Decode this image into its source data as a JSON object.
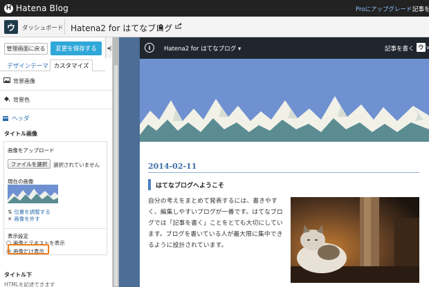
{
  "topbar": {
    "logo_mark": "H",
    "logo_text": "Hatena Blog",
    "pro_link": "Proにアップグレード",
    "write_link": "記事を書"
  },
  "subbar": {
    "blog_icon_text": "ウ",
    "dashboard": "ダッシュボード",
    "blog_title": "Hatena2 for はてなブログ",
    "lock_icon": "lock-icon",
    "caret": "▾",
    "external_icon": "external-link-icon"
  },
  "sidebar": {
    "back_button": "管理画面に戻る",
    "save_button": "変更を保存する",
    "collapse_glyph": "◂|",
    "tabs": [
      {
        "label": "デザインテーマ"
      },
      {
        "label": "カスタマイズ"
      }
    ],
    "sections": [
      {
        "icon": "image-icon",
        "label": "背景画像"
      },
      {
        "icon": "paint-bucket-icon",
        "label": "背景色"
      }
    ],
    "header_link": "ヘッダ",
    "title_image_heading": "タイトル画像",
    "upload_label": "画像をアップロード",
    "file_button": "ファイルを選択",
    "file_note": "選択されていません",
    "current_image_label": "現在の画像",
    "adjust_position": "位置を調整する",
    "remove_image": "画像を外す",
    "display_setting_label": "表示設定",
    "radio_options": [
      {
        "label": "画像とテキストを表示",
        "checked": false
      },
      {
        "label": "画像だけ表示",
        "checked": true
      }
    ],
    "below_title_heading": "タイトル下",
    "below_title_note": "HTMLを記述できます"
  },
  "preview": {
    "logo_mark": "i",
    "blog_title": "Hatena2 for はてなブログ ▾",
    "write_link": "記事を書く",
    "avatar_text": "ウ",
    "avatar_suffix": "v",
    "date": "2014-02-11",
    "post_title": "はてなブログへようこそ",
    "post_body": "自分の考えをまとめて発表するには、書きやすく、編集しやすいブログが一番です。はてなブログでは「記事を書く」ことをとても大切にしています。ブログを書いている人が最大限に集中できるように設計されています。"
  },
  "colors": {
    "accent_blue": "#2fa7d9",
    "link_blue": "#2a6bb0",
    "highlight_orange": "#f07b1a",
    "banner_sky": "#6f91d1",
    "preview_bg": "#4c6d95"
  }
}
